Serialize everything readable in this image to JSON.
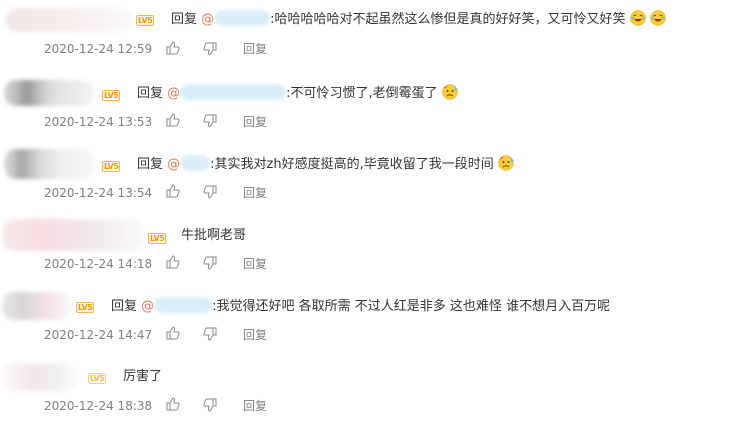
{
  "ui": {
    "reply_label": "回复",
    "reply_button": "回复",
    "level_badge": "LV5",
    "at_sign": "@"
  },
  "comments": [
    {
      "text": ":哈哈哈哈哈对不起虽然这么惨但是真的好好笑，又可怜又好笑",
      "time": "2020-12-24 12:59"
    },
    {
      "text": ":不可怜习惯了,老倒霉蛋了",
      "time": "2020-12-24 13:53"
    },
    {
      "text": ":其实我对zh好感度挺高的,毕竟收留了我一段时间",
      "time": "2020-12-24 13:54"
    },
    {
      "text": "牛批啊老哥",
      "time": "2020-12-24 14:18"
    },
    {
      "text": ":我觉得还好吧 各取所需 不过人红是非多 这也难怪 谁不想月入百万呢",
      "time": "2020-12-24 14:47"
    },
    {
      "text": "厉害了",
      "time": "2020-12-24 18:38"
    }
  ],
  "colors": {
    "mention": "#eb7350",
    "meta": "#808080",
    "badge": "#f39800"
  },
  "icons": [
    "like-icon",
    "dislike-icon",
    "laugh-cry-emoji",
    "sad-sweat-emoji"
  ]
}
